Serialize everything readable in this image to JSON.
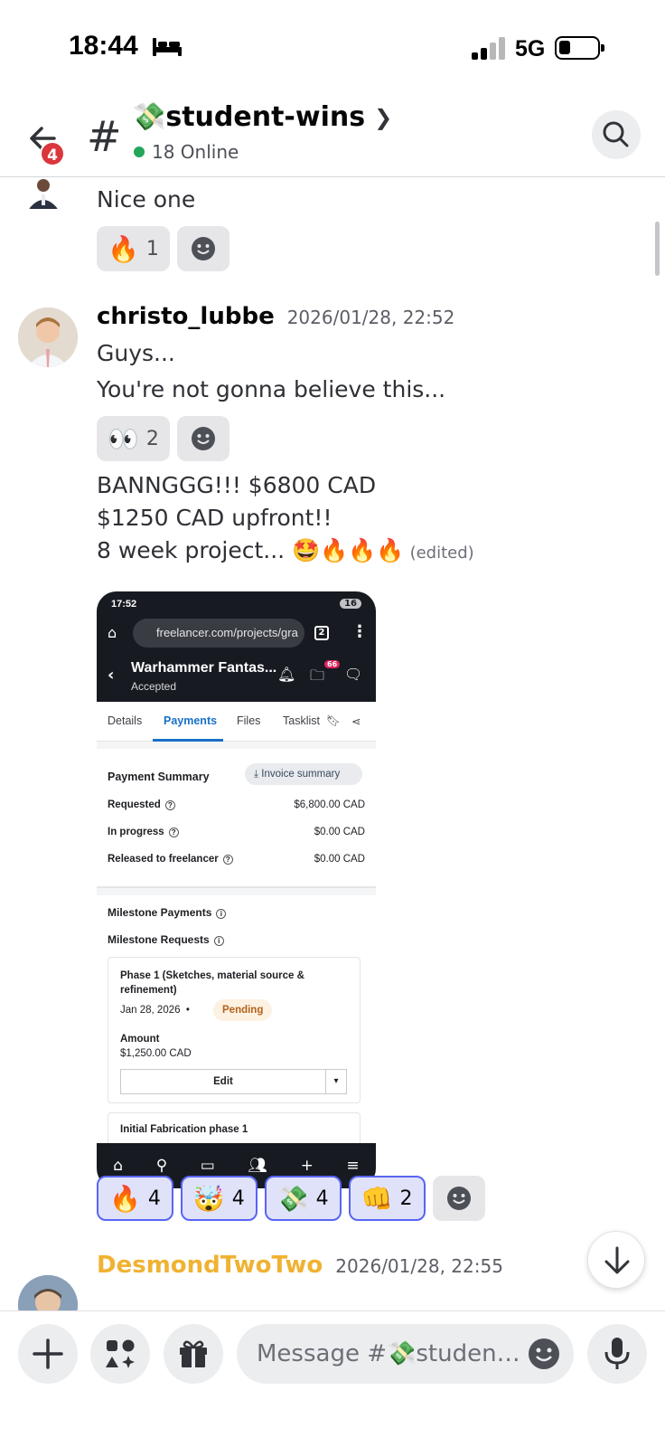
{
  "status_bar": {
    "time": "18:44",
    "network": "5G"
  },
  "header": {
    "unread_badge": "4",
    "channel_name": "💸student-wins",
    "online_count": "18 Online"
  },
  "messages": [
    {
      "text": "Nice one",
      "reactions": [
        {
          "emoji": "🔥",
          "count": "1"
        }
      ]
    },
    {
      "author": "christo_lubbe",
      "timestamp": "2026/01/28, 22:52",
      "lines": [
        "Guys...",
        "You're not gonna believe this..."
      ],
      "reactions": [
        {
          "emoji": "👀",
          "count": "2"
        }
      ],
      "followup_lines": [
        "BANNGGG!!! $6800 CAD",
        "$1250 CAD upfront!!",
        "8 week project... 🤩🔥🔥🔥"
      ],
      "edited_label": "(edited)",
      "attachment": {
        "status_time": "17:52",
        "status_right": "16",
        "url": "freelancer.com/projects/gra",
        "tab_count": "2",
        "project_title": "Warhammer Fantas...",
        "project_status": "Accepted",
        "notif_badge": "66",
        "tabs": [
          "Details",
          "Payments",
          "Files",
          "Tasklist"
        ],
        "active_tab": "Payments",
        "payment_summary": {
          "title": "Payment Summary",
          "invoice_button": "Invoice summary",
          "rows": [
            {
              "label": "Requested",
              "value": "$6,800.00 CAD"
            },
            {
              "label": "In progress",
              "value": "$0.00 CAD"
            },
            {
              "label": "Released to freelancer",
              "value": "$0.00 CAD"
            }
          ]
        },
        "milestones": {
          "payments_title": "Milestone Payments",
          "requests_title": "Milestone Requests",
          "phase_name": "Phase 1 (Sketches, material source & refinement)",
          "phase_date": "Jan 28, 2026",
          "phase_status": "Pending",
          "amount_label": "Amount",
          "amount_value": "$1,250.00 CAD",
          "edit_label": "Edit",
          "next_phase": "Initial Fabrication phase 1"
        }
      },
      "reactions2": [
        {
          "emoji": "🔥",
          "count": "4"
        },
        {
          "emoji": "🤯",
          "count": "4"
        },
        {
          "emoji": "💸",
          "count": "4"
        },
        {
          "emoji": "👊",
          "count": "2"
        }
      ]
    },
    {
      "author": "DesmondTwoTwo",
      "timestamp": "2026/01/28, 22:55",
      "author_color": "#f0b232"
    }
  ],
  "composer": {
    "placeholder": "Message #💸student-wins"
  },
  "colors": {
    "accent": "#5865f2",
    "online": "#23a55a",
    "badge": "#da373c"
  }
}
